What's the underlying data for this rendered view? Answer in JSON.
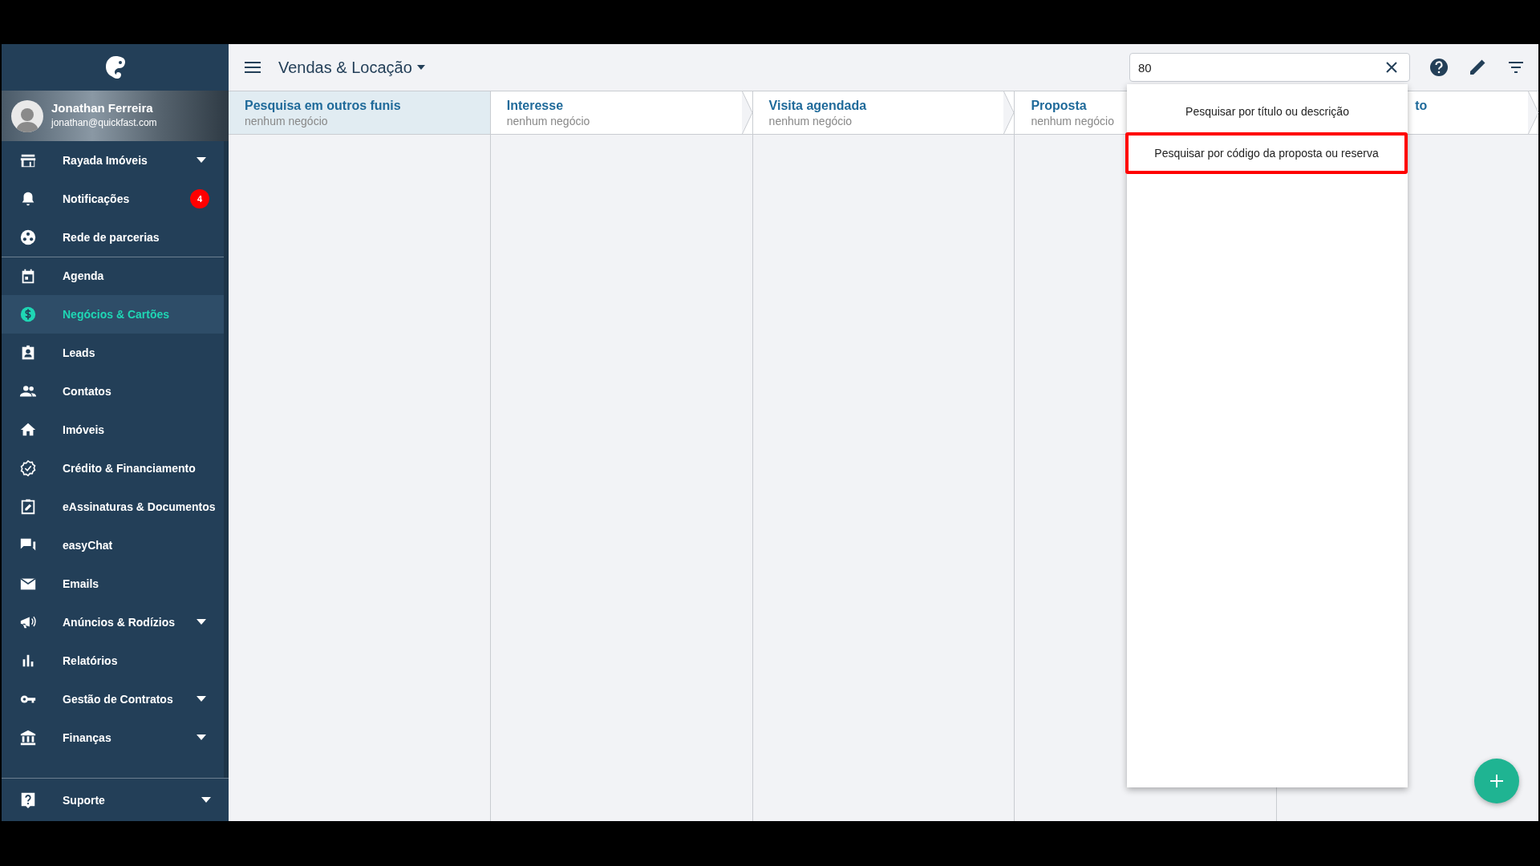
{
  "sidebar": {
    "user": {
      "name": "Jonathan Ferreira",
      "email": "jonathan@quickfast.com"
    },
    "sections": [
      {
        "items": [
          {
            "label": "Rayada Imóveis",
            "selected": false,
            "expandable": true
          },
          {
            "label": "Notificações",
            "selected": false,
            "badge": "4"
          },
          {
            "label": "Rede de parcerias",
            "selected": false
          }
        ]
      },
      {
        "items": [
          {
            "label": "Agenda",
            "selected": false
          },
          {
            "label": "Negócios & Cartões",
            "selected": true
          },
          {
            "label": "Leads",
            "selected": false
          },
          {
            "label": "Contatos",
            "selected": false
          },
          {
            "label": "Imóveis",
            "selected": false
          },
          {
            "label": "Crédito & Financiamento",
            "selected": false
          },
          {
            "label": "eAssinaturas & Documentos",
            "selected": false
          },
          {
            "label": "easyChat",
            "selected": false
          },
          {
            "label": "Emails",
            "selected": false
          },
          {
            "label": "Anúncios & Rodízios",
            "selected": false,
            "expandable": true
          },
          {
            "label": "Relatórios",
            "selected": false
          },
          {
            "label": "Gestão de Contratos",
            "selected": false,
            "expandable": true
          },
          {
            "label": "Finanças",
            "selected": false,
            "expandable": true
          }
        ]
      }
    ],
    "footer": {
      "label": "Suporte",
      "expandable": true
    }
  },
  "topbar": {
    "title": "Vendas & Locação",
    "search": {
      "value": "80"
    }
  },
  "search_menu": {
    "options": [
      {
        "label": "Pesquisar por título ou descrição",
        "highlighted": false
      },
      {
        "label": "Pesquisar por código da proposta ou reserva",
        "highlighted": true
      }
    ]
  },
  "columns": [
    {
      "kind": "search",
      "title": "Pesquisa em outros funis",
      "subtitle": "nenhum negócio"
    },
    {
      "kind": "stage",
      "title": "Interesse",
      "subtitle": "nenhum negócio"
    },
    {
      "kind": "stage",
      "title": "Visita agendada",
      "subtitle": "nenhum negócio"
    },
    {
      "kind": "stage",
      "title": "Proposta",
      "subtitle": "nenhum negócio"
    },
    {
      "kind": "covered",
      "title": "to"
    }
  ]
}
